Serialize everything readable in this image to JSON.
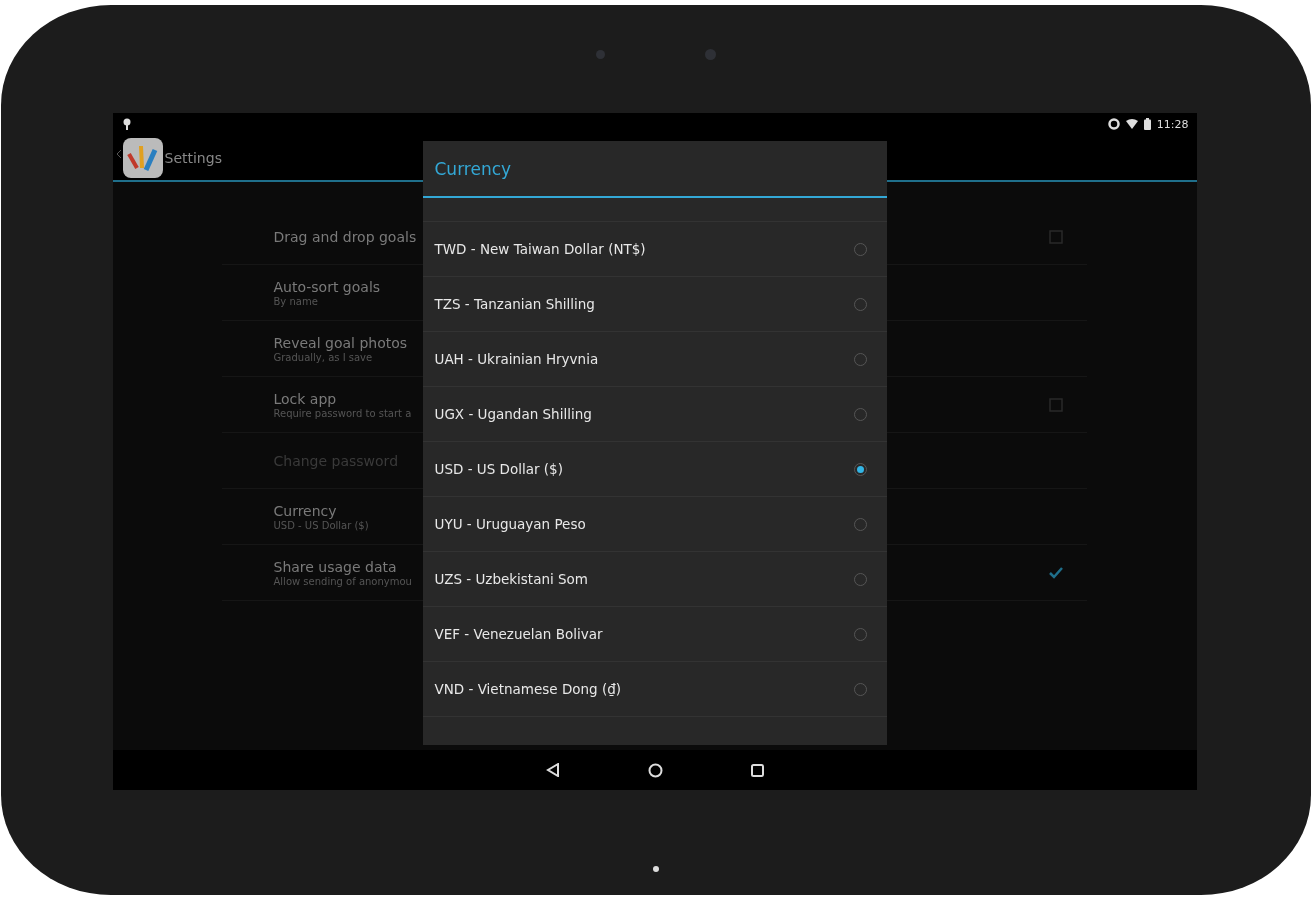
{
  "status_bar": {
    "time": "11:28"
  },
  "action_bar": {
    "title": "Settings"
  },
  "settings": [
    {
      "title": "Drag and drop goals",
      "kind": "checkbox",
      "checked": false,
      "disabled": false
    },
    {
      "title": "Auto-sort goals",
      "summary": "By name",
      "kind": "text",
      "disabled": false
    },
    {
      "title": "Reveal goal photos",
      "summary": "Gradually, as I save",
      "kind": "text",
      "disabled": false
    },
    {
      "title": "Lock app",
      "summary": "Require password to start a",
      "kind": "checkbox",
      "checked": false,
      "disabled": false
    },
    {
      "title": "Change password",
      "kind": "text",
      "disabled": true
    },
    {
      "title": "Currency",
      "summary": "USD - US Dollar ($)",
      "kind": "text",
      "disabled": false
    },
    {
      "title": "Share usage data",
      "summary": "Allow sending of anonymou",
      "kind": "checkbox",
      "checked": true,
      "disabled": false
    }
  ],
  "dialog": {
    "title": "Currency",
    "options": [
      {
        "label": "TWD - New Taiwan Dollar (NT$)",
        "selected": false
      },
      {
        "label": "TZS - Tanzanian Shilling",
        "selected": false
      },
      {
        "label": "UAH - Ukrainian Hryvnia",
        "selected": false
      },
      {
        "label": "UGX - Ugandan Shilling",
        "selected": false
      },
      {
        "label": "USD - US Dollar ($)",
        "selected": true
      },
      {
        "label": "UYU - Uruguayan Peso",
        "selected": false
      },
      {
        "label": "UZS - Uzbekistani Som",
        "selected": false
      },
      {
        "label": "VEF - Venezuelan Bolivar",
        "selected": false
      },
      {
        "label": "VND - Vietnamese Dong (₫)",
        "selected": false
      }
    ]
  }
}
